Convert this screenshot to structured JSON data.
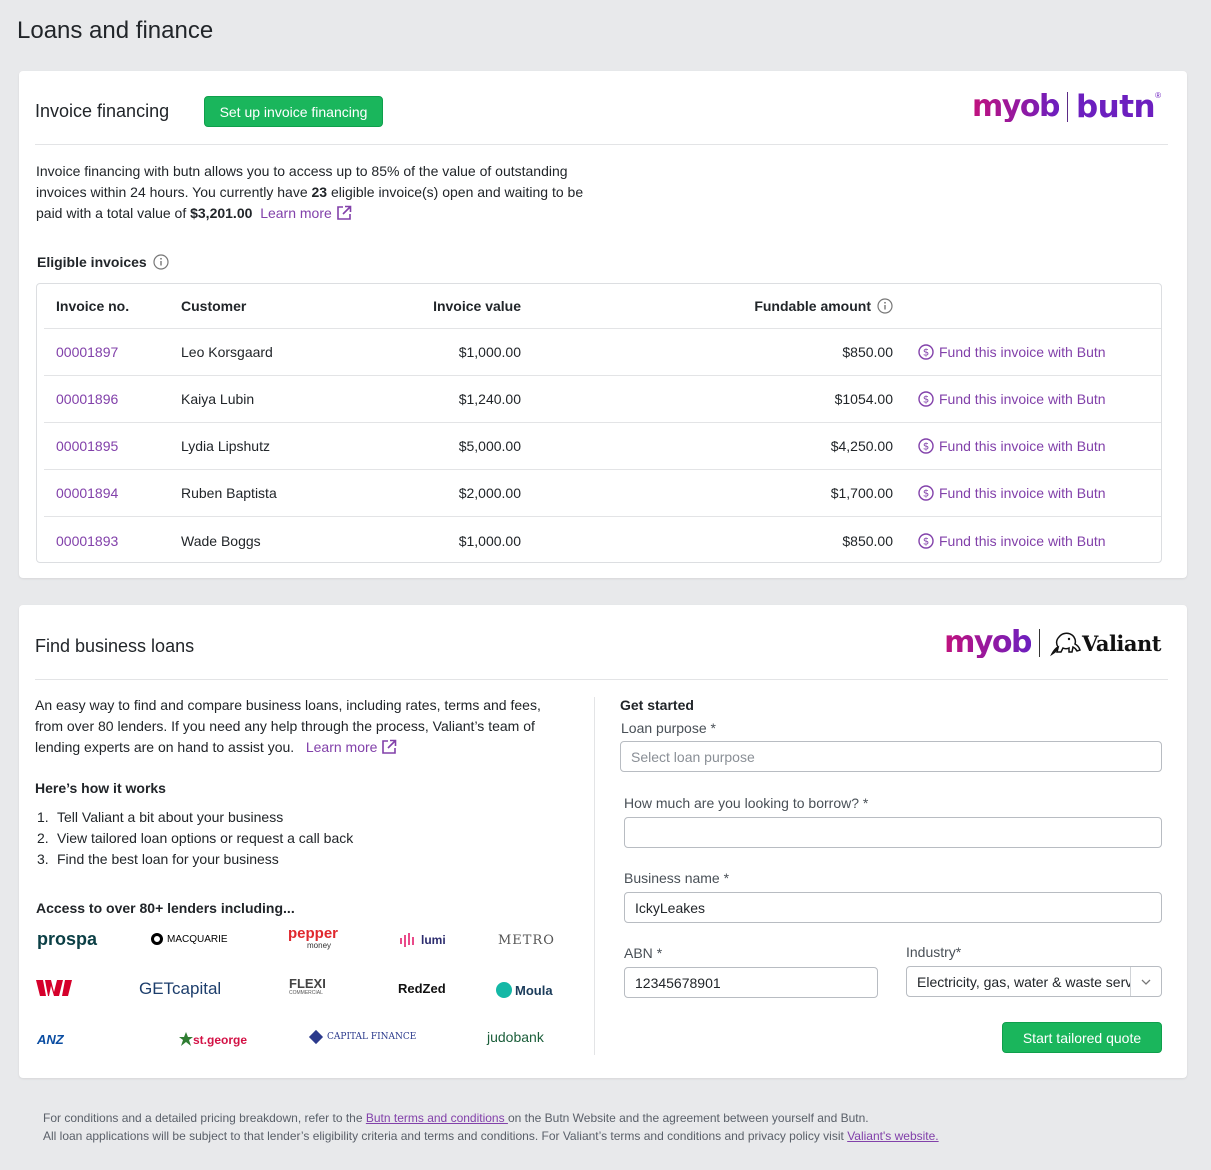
{
  "page": {
    "title": "Loans and finance"
  },
  "invoice_financing": {
    "title": "Invoice financing",
    "setup_button": "Set up invoice financing",
    "logo": {
      "left": "myob",
      "right": "butn"
    },
    "description_1": "Invoice financing with butn allows you to access up to 85% of the value of outstanding",
    "description_2a": "invoices within 24 hours. You currently have ",
    "eligible_count": "23",
    "description_2b": " eligible invoice(s) open and waiting to be",
    "description_3a": "paid with a total value of ",
    "total_value": "$3,201.00",
    "learn_more": "Learn more",
    "eligible_label": "Eligible invoices",
    "columns": {
      "invoice_no": "Invoice no.",
      "customer": "Customer",
      "invoice_value": "Invoice value",
      "fundable": "Fundable amount"
    },
    "rows": [
      {
        "invoice_no": "00001897",
        "customer": "Leo Korsgaard",
        "value": "$1,000.00",
        "fundable": "$850.00",
        "action": "Fund this invoice with Butn"
      },
      {
        "invoice_no": "00001896",
        "customer": "Kaiya Lubin",
        "value": "$1,240.00",
        "fundable": "$1054.00",
        "action": "Fund this invoice with Butn"
      },
      {
        "invoice_no": "00001895",
        "customer": "Lydia Lipshutz",
        "value": "$5,000.00",
        "fundable": "$4,250.00",
        "action": "Fund this invoice with Butn"
      },
      {
        "invoice_no": "00001894",
        "customer": "Ruben Baptista",
        "value": "$2,000.00",
        "fundable": "$1,700.00",
        "action": "Fund this invoice with Butn"
      },
      {
        "invoice_no": "00001893",
        "customer": "Wade Boggs",
        "value": "$1,000.00",
        "fundable": "$850.00",
        "action": "Fund this invoice with Butn"
      }
    ]
  },
  "business_loans": {
    "title": "Find business loans",
    "logo": {
      "left": "myob",
      "right": "Valiant"
    },
    "description_1": "An easy way to find and compare business loans, including rates, terms and fees,",
    "description_2": "from over 80 lenders. If you need any help through the process, Valiant’s team of",
    "description_3": "lending experts are on hand to assist you.",
    "learn_more": "Learn more",
    "how_title": "Here’s how it works",
    "steps": [
      {
        "n": "1.",
        "text": "Tell Valiant a bit about your business"
      },
      {
        "n": "2.",
        "text": "View tailored loan options or request a call back"
      },
      {
        "n": "3.",
        "text": "Find the best loan for your business"
      }
    ],
    "lenders_title": "Access to over 80+ lenders including...",
    "lenders": [
      "prospa",
      "MACQUARIE",
      "pepper",
      "money",
      "lumi",
      "METRO",
      "W",
      "GETcapital",
      "FLEXI",
      "COMMERCIAL",
      "RedZed",
      "Moula",
      "ANZ",
      "st.george",
      "CAPITAL FINANCE",
      "judobank"
    ],
    "form": {
      "heading": "Get started",
      "loan_purpose_label": "Loan purpose",
      "loan_purpose_placeholder": "Select loan purpose",
      "borrow_label": "How much are you looking to borrow?",
      "borrow_value": "",
      "business_label": "Business name",
      "business_value": "IckyLeakes",
      "abn_label": "ABN",
      "abn_value": "12345678901",
      "industry_label": "Industry*",
      "industry_value": "Electricity, gas, water & waste services",
      "required_mark": "*",
      "submit": "Start tailored quote"
    }
  },
  "footer": {
    "line1a": "For conditions and a detailed pricing breakdown, refer to the ",
    "line1_link": "Butn terms and conditions ",
    "line1b": "on the Butn Website and the agreement between yourself and Butn.",
    "line2a": "All loan applications will be subject to that lender’s eligibility criteria and terms and conditions. For Valiant’s terms and conditions and privacy policy visit ",
    "line2_link": "Valiant's website. "
  },
  "colors": {
    "accent_green": "#1ab65c",
    "link_purple": "#8241aa",
    "brand_magenta": "#c1127d",
    "brand_purple": "#6c1fbf"
  }
}
